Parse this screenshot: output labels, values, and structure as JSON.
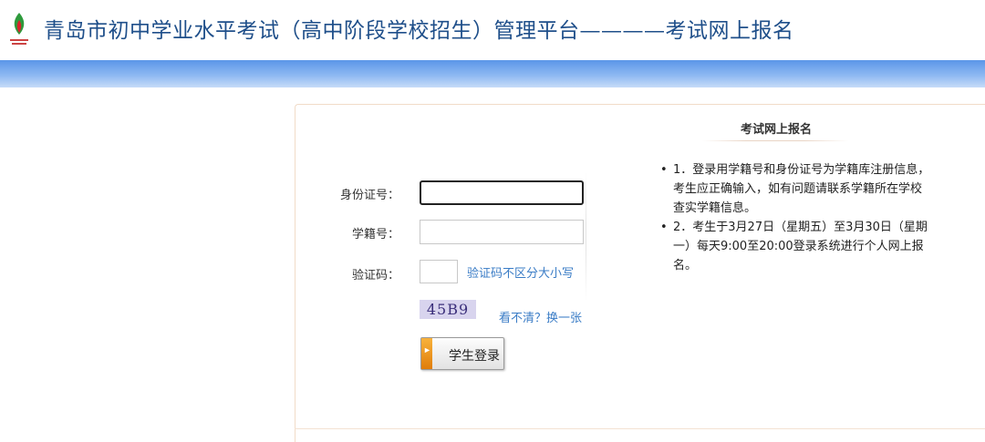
{
  "header": {
    "title": "青岛市初中学业水平考试（高中阶段学校招生）管理平台————考试网上报名",
    "logo_icon": "green-red-flame-emblem-icon"
  },
  "form": {
    "id_label": "身份证号：",
    "id_value": "",
    "student_no_label": "学籍号：",
    "student_no_value": "",
    "captcha_label": "验证码：",
    "captcha_value": "",
    "captcha_hint": "验证码不区分大小写",
    "captcha_text": "45B9",
    "refresh_link": "看不清？换一张",
    "login_button": "学生登录"
  },
  "notice": {
    "title": "考试网上报名",
    "items": [
      "1．登录用学籍号和身份证号为学籍库注册信息，考生应正确输入，如有问题请联系学籍所在学校查实学籍信息。",
      "2．考生于3月27日（星期五）至3月30日（星期一）每天9:00至20:00登录系统进行个人网上报名。"
    ]
  },
  "colors": {
    "title": "#1f4f8a",
    "banner": "#5b96e8",
    "link": "#3a7cc6",
    "button_accent": "#f8b23c"
  }
}
